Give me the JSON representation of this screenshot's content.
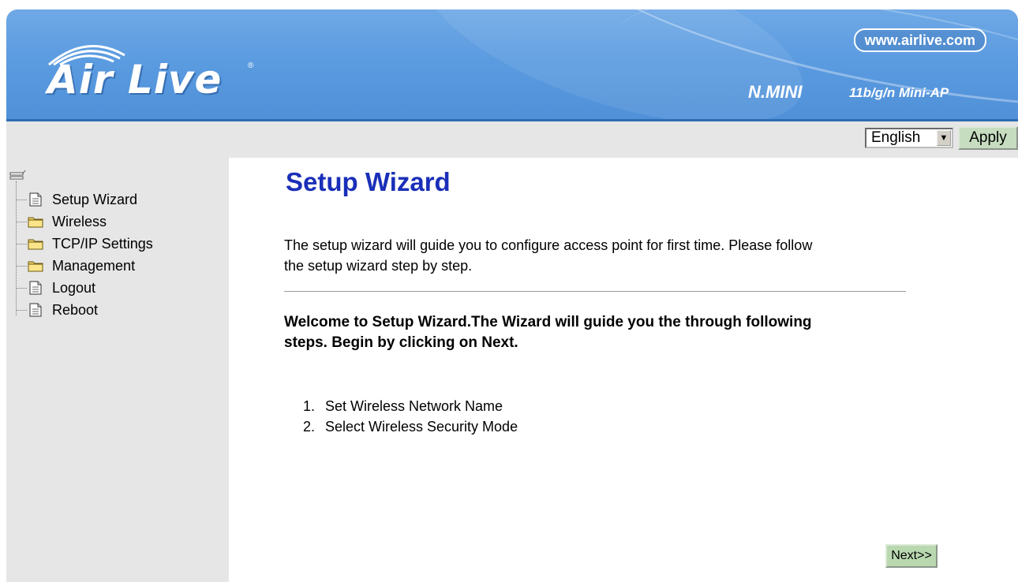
{
  "header": {
    "logo_text": "Air Live",
    "website": "www.airlive.com",
    "model": "N.MINI",
    "model_description": "11b/g/n Mini-AP"
  },
  "toolbar": {
    "language_selected": "English",
    "apply_label": "Apply"
  },
  "sidebar": {
    "items": [
      {
        "label": "Setup Wizard",
        "icon": "page-icon"
      },
      {
        "label": "Wireless",
        "icon": "folder-icon"
      },
      {
        "label": "TCP/IP Settings",
        "icon": "folder-icon"
      },
      {
        "label": "Management",
        "icon": "folder-icon"
      },
      {
        "label": "Logout",
        "icon": "page-icon"
      },
      {
        "label": "Reboot",
        "icon": "page-icon"
      }
    ]
  },
  "main": {
    "title": "Setup Wizard",
    "intro_line1": "The setup wizard will guide you to configure access point for first time. Please follow",
    "intro_line2": "the setup wizard step by step.",
    "welcome_line1": "Welcome to Setup Wizard.The Wizard will guide you the through following",
    "welcome_line2": "steps. Begin by clicking on Next.",
    "steps": [
      {
        "num": "1.",
        "text": "Set Wireless Network Name"
      },
      {
        "num": "2.",
        "text": "Select Wireless Security Mode"
      }
    ],
    "next_label": "Next>>"
  },
  "colors": {
    "banner_blue": "#5b9be0",
    "title_blue": "#1a2fb8",
    "button_green": "#c6ddbf",
    "sidebar_gray": "#e6e6e6"
  }
}
